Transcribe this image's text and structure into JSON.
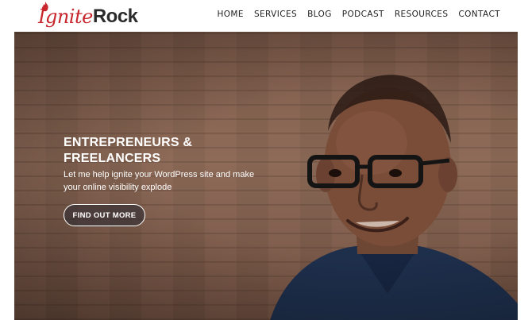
{
  "brand": {
    "part1": "Ignite",
    "part2": "Rock"
  },
  "nav": {
    "items": [
      "HOME",
      "SERVICES",
      "BLOG",
      "PODCAST",
      "RESOURCES",
      "CONTACT"
    ]
  },
  "hero": {
    "headline": "ENTREPRENEURS & FREELANCERS",
    "subline": "Let me help ignite your WordPress site and make your online visibility explode",
    "cta_label": "FIND OUT MORE"
  },
  "colors": {
    "brand_red": "#c8252c",
    "brand_dark": "#2b2b2b",
    "shirt": "#1e2f4c"
  }
}
